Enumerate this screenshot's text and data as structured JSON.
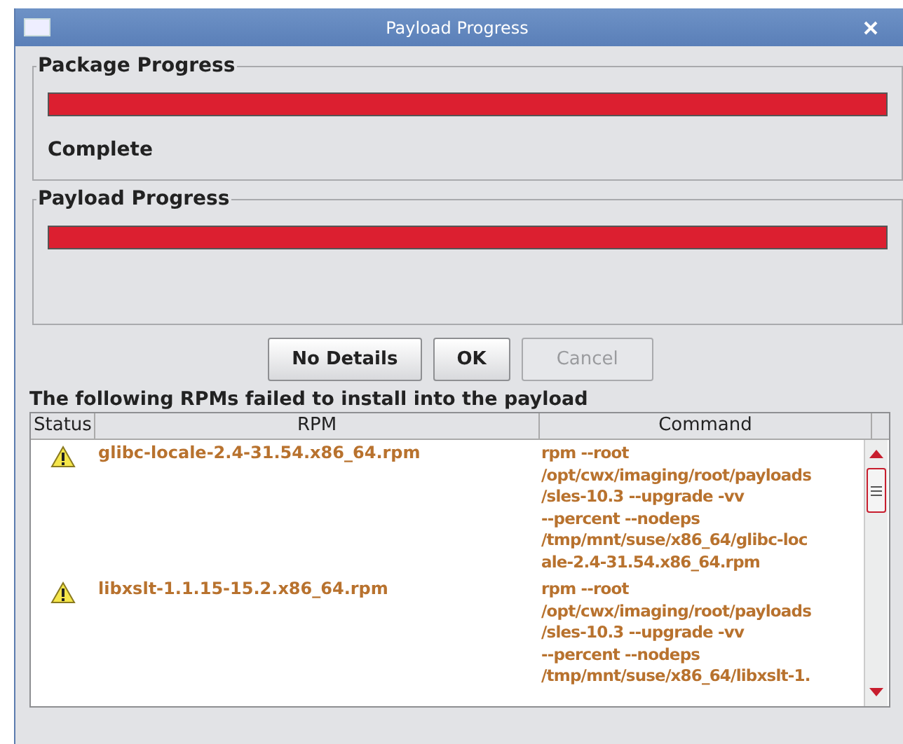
{
  "window": {
    "title": "Payload Progress"
  },
  "package_progress": {
    "title": "Package Progress",
    "level": 1.0,
    "status": "Complete"
  },
  "payload_progress": {
    "title": "Payload Progress",
    "level": 1.0
  },
  "buttons": [
    {
      "label": "No Details",
      "disabled": false
    },
    {
      "label": "OK",
      "disabled": false
    },
    {
      "label": "Cancel",
      "disabled": true
    }
  ],
  "failed_label": "The following RPMs failed to install into the payload",
  "table": {
    "columns": [
      "Status",
      "RPM",
      "Command"
    ],
    "rows": [
      {
        "warning": true,
        "rpm": "glibc-locale-2.4-31.54.x86_64.rpm",
        "command": [
          "rpm --root",
          "/opt/cwx/imaging/root/payloads",
          "/sles-10.3 --upgrade -vv",
          "--percent --nodeps",
          "/tmp/mnt/suse/x86_64/glibc-loc",
          "ale-2.4-31.54.x86_64.rpm"
        ]
      },
      {
        "warning": true,
        "rpm": "libxslt-1.1.15-15.2.x86_64.rpm",
        "command": [
          "rpm --root",
          "/opt/cwx/imaging/root/payloads",
          "/sles-10.3 --upgrade -vv",
          "--percent --nodeps",
          "/tmp/mnt/suse/x86_64/libxslt-1."
        ]
      }
    ]
  }
}
